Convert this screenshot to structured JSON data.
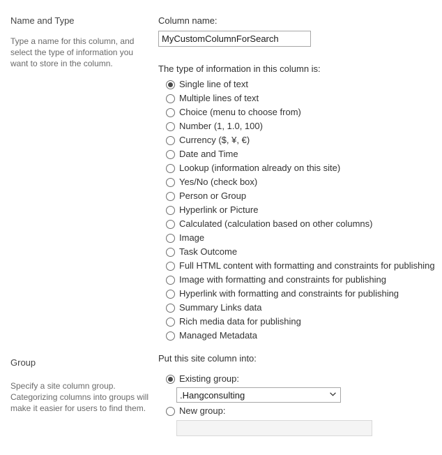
{
  "name_and_type": {
    "title": "Name and Type",
    "description": "Type a name for this column, and select the type of information you want to store in the column.",
    "column_name_label": "Column name:",
    "column_name_value": "MyCustomColumnForSearch",
    "column_name_placeholder": "",
    "type_label": "The type of information in this column is:",
    "selected_type": "Single line of text",
    "types": [
      "Single line of text",
      "Multiple lines of text",
      "Choice (menu to choose from)",
      "Number (1, 1.0, 100)",
      "Currency ($, ¥, €)",
      "Date and Time",
      "Lookup (information already on this site)",
      "Yes/No (check box)",
      "Person or Group",
      "Hyperlink or Picture",
      "Calculated (calculation based on other columns)",
      "Image",
      "Task Outcome",
      "Full HTML content with formatting and constraints for publishing",
      "Image with formatting and constraints for publishing",
      "Hyperlink with formatting and constraints for publishing",
      "Summary Links data",
      "Rich media data for publishing",
      "Managed Metadata"
    ]
  },
  "group": {
    "title": "Group",
    "description": "Specify a site column group. Categorizing columns into groups will make it easier for users to find them.",
    "put_into_label": "Put this site column into:",
    "existing_group_label": "Existing group:",
    "existing_group_value": ".Hangconsulting",
    "existing_group_options": [
      ".Hangconsulting"
    ],
    "new_group_label": "New group:",
    "new_group_value": "",
    "new_group_placeholder": "",
    "selected_option": "Existing group:"
  },
  "icons": {
    "chevron_down": "chevron-down-icon"
  },
  "colors": {
    "text": "#333333",
    "muted_text": "#6a6a6a",
    "border": "#a7a7a7",
    "disabled_bg": "#f4f4f4",
    "background": "#ffffff"
  }
}
